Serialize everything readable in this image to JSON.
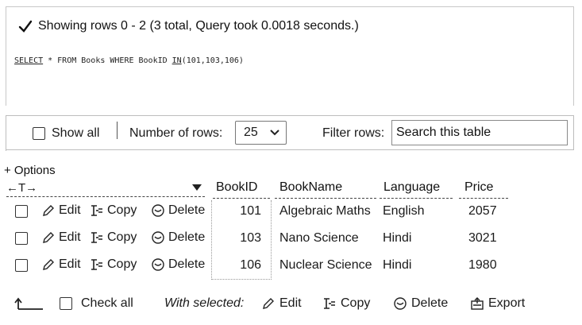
{
  "message": {
    "text": "Showing rows 0 - 2 (3 total, Query took 0.0018 seconds.)"
  },
  "sql": {
    "keyword_select": "SELECT",
    "star": "*",
    "middle": "FROM Books WHERE BookID",
    "keyword_in": "IN",
    "values": "(101,103,106)"
  },
  "toolbar": {
    "show_all_label": "Show all",
    "rows_label": "Number of rows:",
    "rows_value": "25",
    "filter_label": "Filter rows:",
    "filter_placeholder": "Search this table"
  },
  "options_label": "+ Options",
  "columns": {
    "arrows": "←T→",
    "id": "BookID",
    "name": "BookName",
    "language": "Language",
    "price": "Price"
  },
  "actions": {
    "edit": "Edit",
    "copy": "Copy",
    "delete": "Delete"
  },
  "rows": [
    {
      "id": "101",
      "name": "Algebraic Maths",
      "language": "English",
      "price": "2057"
    },
    {
      "id": "103",
      "name": "Nano Science",
      "language": "Hindi",
      "price": "3021"
    },
    {
      "id": "106",
      "name": "Nuclear Science",
      "language": "Hindi",
      "price": "1980"
    }
  ],
  "bottom": {
    "check_all": "Check all",
    "with_selected": "With selected:",
    "edit": "Edit",
    "copy": "Copy",
    "delete": "Delete",
    "export": "Export"
  },
  "colors": {
    "border": "#c8c8c8",
    "text": "#1a1a1a"
  }
}
